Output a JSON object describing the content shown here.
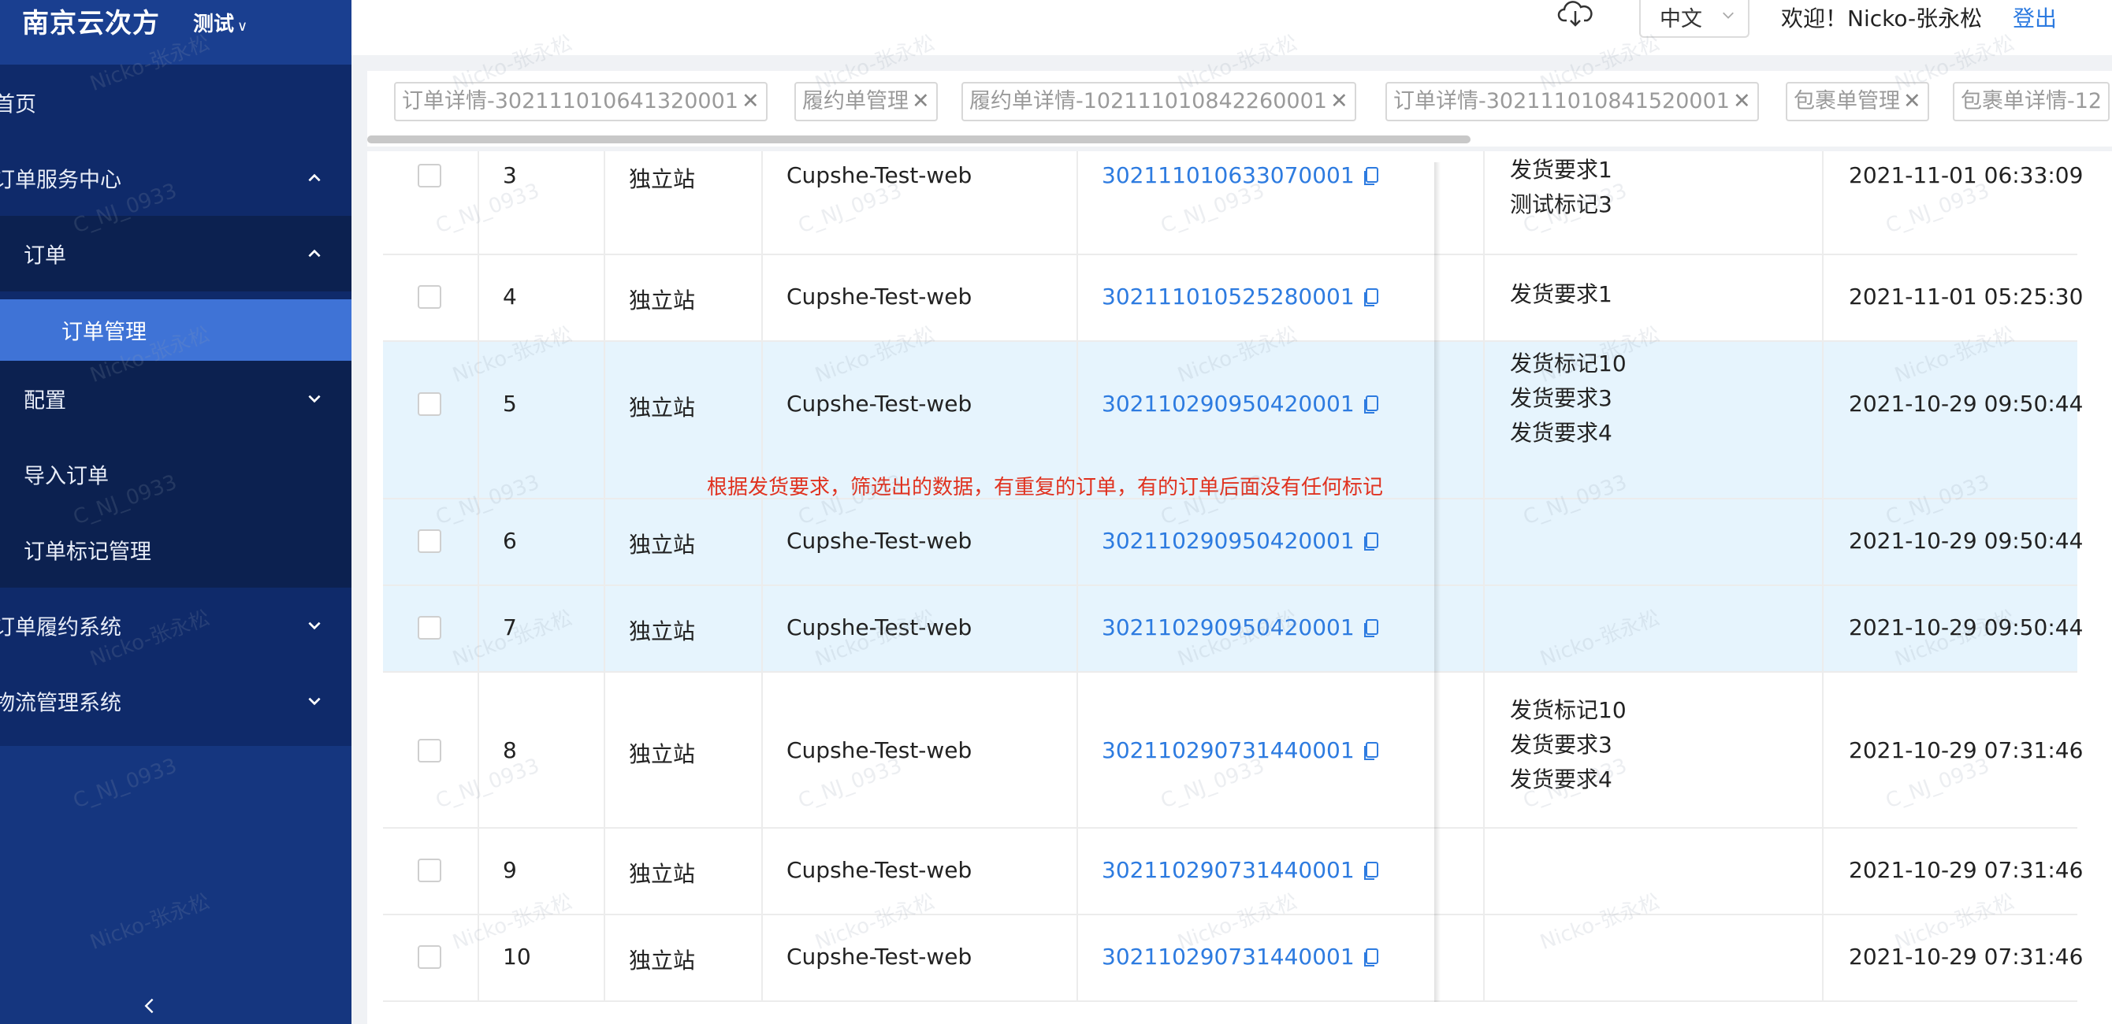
{
  "header": {
    "brand": "南京云次方",
    "env_label": "测试",
    "language": "中文",
    "welcome": "欢迎！Nicko-张永松",
    "logout": "登出"
  },
  "sidebar": {
    "items": [
      {
        "label": "首页"
      },
      {
        "label": "订单服务中心"
      },
      {
        "label": "订单"
      },
      {
        "label": "订单管理"
      },
      {
        "label": "配置"
      },
      {
        "label": "导入订单"
      },
      {
        "label": "订单标记管理"
      },
      {
        "label": "订单履约系统"
      },
      {
        "label": "物流管理系统"
      }
    ]
  },
  "tabs": [
    {
      "label": "订单详情-302111010641320001"
    },
    {
      "label": "履约单管理"
    },
    {
      "label": "履约单详情-102111010842260001"
    },
    {
      "label": "订单详情-302111010841520001"
    },
    {
      "label": "包裹单管理"
    },
    {
      "label": "包裹单详情-12"
    }
  ],
  "table": {
    "rows": [
      {
        "no": "3",
        "channel": "独立站",
        "store": "Cupshe-Test-web",
        "order": "302111010633070001",
        "marks": [
          "发货要求1",
          "测试标记3"
        ],
        "time": "2021-11-01 06:33:09",
        "highlight": false
      },
      {
        "no": "4",
        "channel": "独立站",
        "store": "Cupshe-Test-web",
        "order": "302111010525280001",
        "marks": [
          "发货要求1"
        ],
        "time": "2021-11-01 05:25:30",
        "highlight": false
      },
      {
        "no": "5",
        "channel": "独立站",
        "store": "Cupshe-Test-web",
        "order": "302110290950420001",
        "marks": [
          "发货标记10",
          "发货要求3",
          "发货要求4"
        ],
        "time": "2021-10-29 09:50:44",
        "highlight": true
      },
      {
        "no": "6",
        "channel": "独立站",
        "store": "Cupshe-Test-web",
        "order": "302110290950420001",
        "marks": [],
        "time": "2021-10-29 09:50:44",
        "highlight": true
      },
      {
        "no": "7",
        "channel": "独立站",
        "store": "Cupshe-Test-web",
        "order": "302110290950420001",
        "marks": [],
        "time": "2021-10-29 09:50:44",
        "highlight": true
      },
      {
        "no": "8",
        "channel": "独立站",
        "store": "Cupshe-Test-web",
        "order": "302110290731440001",
        "marks": [
          "发货标记10",
          "发货要求3",
          "发货要求4"
        ],
        "time": "2021-10-29 07:31:46",
        "highlight": false
      },
      {
        "no": "9",
        "channel": "独立站",
        "store": "Cupshe-Test-web",
        "order": "302110290731440001",
        "marks": [],
        "time": "2021-10-29 07:31:46",
        "highlight": false
      },
      {
        "no": "10",
        "channel": "独立站",
        "store": "Cupshe-Test-web",
        "order": "302110290731440001",
        "marks": [],
        "time": "2021-10-29 07:31:46",
        "highlight": false
      }
    ]
  },
  "annotation": "根据发货要求，筛选出的数据，有重复的订单，有的订单后面没有任何标记",
  "watermarks": [
    "Nicko-张永松",
    "C_NJ_0933"
  ],
  "colors": {
    "sidebar": "#15367f",
    "active_menu": "#3f73d6",
    "link": "#2d7be0",
    "annotation": "#e0321f",
    "row_highlight": "#e6f4fd"
  }
}
